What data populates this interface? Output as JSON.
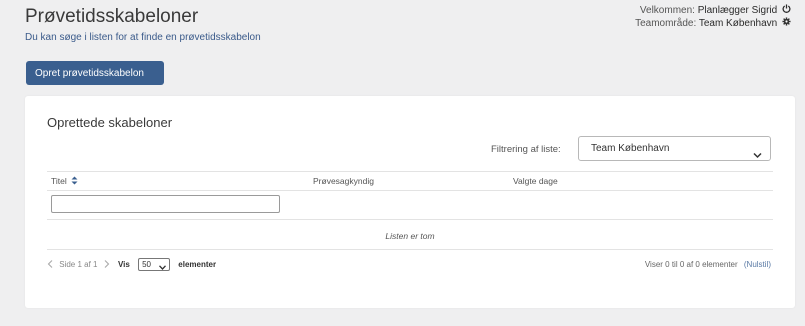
{
  "header": {
    "title": "Prøvetidsskabeloner",
    "subtitle": "Du kan søge i listen for at finde en prøvetidsskabelon",
    "welcome_label": "Velkommen:",
    "user_name": "Planlægger Sigrid",
    "team_label": "Teamområde:",
    "team_name": "Team København"
  },
  "actions": {
    "create_label": "Opret prøvetidsskabelon"
  },
  "panel": {
    "title": "Oprettede skabeloner",
    "filter_label": "Filtrering af liste:",
    "filter_value": "Team København"
  },
  "table": {
    "columns": [
      "Titel",
      "Prøvesagkyndig",
      "Valgte dage"
    ],
    "title_filter_value": "",
    "empty_text": "Listen er tom"
  },
  "pager": {
    "page_info": "Side 1 af 1",
    "show_label": "Vis",
    "per_page": "50",
    "elements_label": "elementer",
    "info": "Viser 0 til 0 af 0 elementer",
    "reset_label": "(Nulstil)"
  },
  "colors": {
    "primary": "#3a5f8f",
    "background": "#efeff0"
  }
}
